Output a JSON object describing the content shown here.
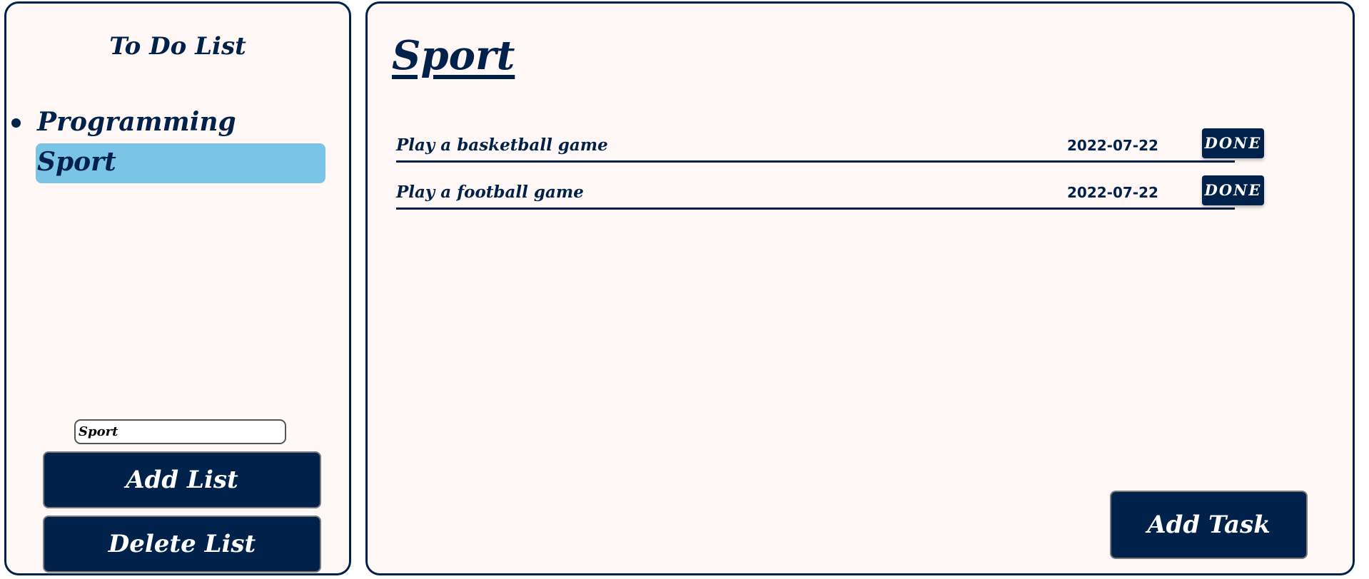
{
  "sidebar": {
    "title": "To Do List",
    "lists": [
      {
        "label": "Programming",
        "selected": false
      },
      {
        "label": "Sport",
        "selected": true
      }
    ],
    "input_value": "Sport",
    "add_list_label": "Add List",
    "delete_list_label": "Delete List"
  },
  "main": {
    "title": "Sport",
    "tasks": [
      {
        "text": "Play a basketball game",
        "date": "2022-07-22",
        "done_label": "DONE"
      },
      {
        "text": "Play a football game",
        "date": "2022-07-22",
        "done_label": "DONE"
      }
    ],
    "add_task_label": "Add Task"
  },
  "colors": {
    "primary": "#00224a",
    "selected": "#7ac4e8",
    "panel_background": "#fff8f6"
  },
  "icons": {
    "list_bullet": "bullet-icon"
  }
}
